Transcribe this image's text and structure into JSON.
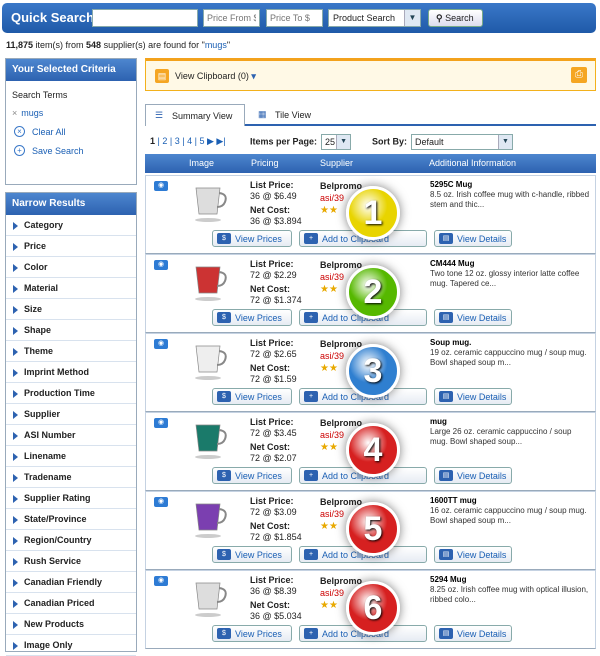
{
  "quick_search": {
    "title": "Quick Search",
    "query": "",
    "price_from_placeholder": "Price From $",
    "price_to_placeholder": "Price To $",
    "type_selected": "Product Search",
    "search_label": "Search"
  },
  "results": {
    "count": "11,875",
    "count_suffix": " item(s) from ",
    "suppliers": "548",
    "suffix": " supplier(s) are found for \"",
    "term": "mugs",
    "close": "\""
  },
  "criteria": {
    "title": "Your Selected Criteria",
    "search_terms_label": "Search Terms",
    "term": "mugs",
    "clear_all": "Clear All",
    "save_search": "Save Search"
  },
  "narrow": {
    "title": "Narrow Results",
    "items": [
      "Category",
      "Price",
      "Color",
      "Material",
      "Size",
      "Shape",
      "Theme",
      "Imprint Method",
      "Production Time",
      "Supplier",
      "ASI Number",
      "Linename",
      "Tradename",
      "Supplier Rating",
      "State/Province",
      "Region/Country",
      "Rush Service",
      "Canadian Friendly",
      "Canadian Priced",
      "New Products",
      "Image Only"
    ]
  },
  "clipboard": {
    "label": "View Clipboard (0)"
  },
  "tabs": {
    "summary": "Summary View",
    "tile": "Tile View"
  },
  "pager": {
    "pages": [
      "1",
      "2",
      "3",
      "4",
      "5"
    ],
    "items_per_page_label": "Items per Page:",
    "items_per_page": "25",
    "sort_label": "Sort By:",
    "sort_value": "Default"
  },
  "columns": {
    "image": "Image",
    "pricing": "Pricing",
    "supplier": "Supplier",
    "info": "Additional Information"
  },
  "buttons": {
    "view_prices": "View Prices",
    "add_clipboard": "Add to Clipboard",
    "view_details": "View Details"
  },
  "labels": {
    "list_price": "List Price:",
    "net_cost": "Net Cost:"
  },
  "colors": {
    "badge_1": "#e8d400",
    "badge_2": "#56b800",
    "badge_3": "#2f7fd0",
    "badge_4": "#d62020",
    "badge_5": "#d62020",
    "badge_6": "#d62020"
  },
  "products": [
    {
      "num": "1",
      "list": "36 @ $6.49",
      "net": "36 @ $3.894",
      "supplier": "Belpromo",
      "asi": "asi/39",
      "rating": "(1)",
      "code": "5295C  Mug",
      "desc": "8.5 oz. Irish coffee mug with c-handle, ribbed stem and thic..."
    },
    {
      "num": "2",
      "list": "72 @ $2.29",
      "net": "72 @ $1.374",
      "supplier": "Belpromo",
      "asi": "asi/39",
      "rating": "(1)",
      "code": "CM444  Mug",
      "desc": "Two tone 12 oz. glossy interior latte coffee mug. Tapered ce..."
    },
    {
      "num": "3",
      "list": "72 @ $2.65",
      "net": "72 @ $1.59",
      "supplier": "Belpromo",
      "asi": "asi/39",
      "rating": "",
      "code": "Soup mug.",
      "desc": "19 oz. ceramic cappuccino mug / soup mug. Bowl shaped soup m..."
    },
    {
      "num": "4",
      "list": "72 @ $3.45",
      "net": "72 @ $2.07",
      "supplier": "Belpromo",
      "asi": "asi/39",
      "rating": "(1)",
      "code": "mug",
      "desc": "Large 26 oz. ceramic cappuccino / soup mug. Bowl shaped soup..."
    },
    {
      "num": "5",
      "list": "72 @ $3.09",
      "net": "72 @ $1.854",
      "supplier": "Belpromo",
      "asi": "asi/39",
      "rating": "(1)",
      "code": "1600TT  mug",
      "desc": "16 oz. ceramic cappuccino mug / soup mug. Bowl shaped soup m..."
    },
    {
      "num": "6",
      "list": "36 @ $8.39",
      "net": "36 @ $5.034",
      "supplier": "Belpromo",
      "asi": "asi/39",
      "rating": "(1)",
      "code": "5294  Mug",
      "desc": "8.25 oz. Irish coffee mug with optical illusion, ribbed colo..."
    }
  ]
}
